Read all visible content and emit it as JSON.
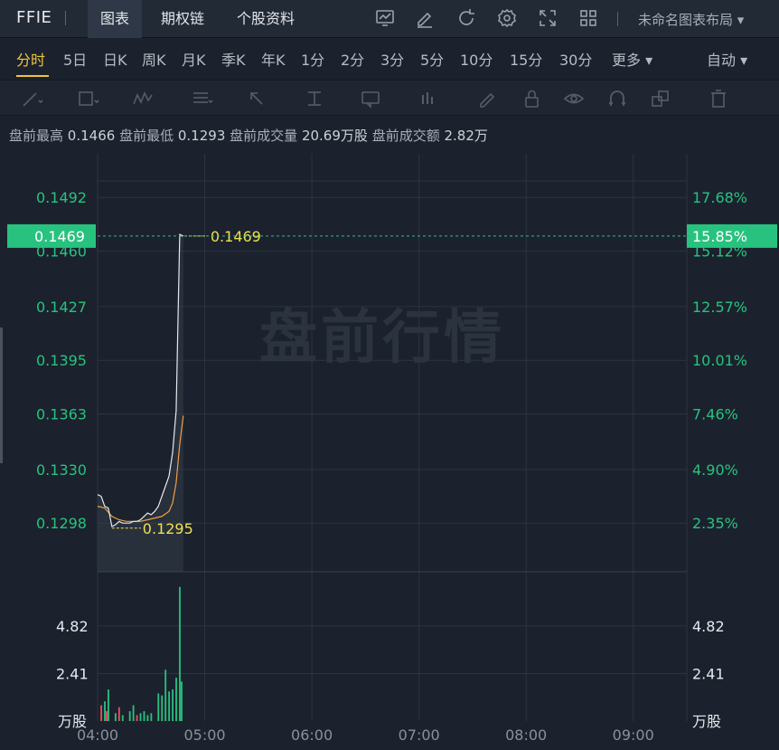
{
  "header": {
    "ticker": "FFIE",
    "tabs": [
      {
        "label": "图表",
        "active": true
      },
      {
        "label": "期权链",
        "active": false
      },
      {
        "label": "个股资料",
        "active": false
      }
    ],
    "icons": [
      "chart-add-icon",
      "edit-icon",
      "refresh-icon",
      "gear-icon",
      "fullscreen-icon",
      "grid-icon"
    ],
    "layout_label": "未命名图表布局"
  },
  "periods": {
    "items": [
      "分时",
      "5日",
      "日K",
      "周K",
      "月K",
      "季K",
      "年K",
      "1分",
      "2分",
      "3分",
      "5分",
      "10分",
      "15分",
      "30分",
      "更多"
    ],
    "active": "分时",
    "mode": "自动"
  },
  "draw_tools": [
    "line-tool-icon",
    "rect-tool-icon",
    "wave-tool-icon",
    "fib-tool-icon",
    "arrow-tool-icon",
    "text-level-icon",
    "text-label-icon",
    "bar-pattern-icon",
    "brush-icon",
    "lock-icon",
    "eye-icon",
    "magnet-icon",
    "layers-icon",
    "trash-icon"
  ],
  "info": {
    "high_label": "盘前最高",
    "high": "0.1466",
    "low_label": "盘前最低",
    "low": "0.1293",
    "volume_label": "盘前成交量",
    "volume": "20.69万股",
    "amount_label": "盘前成交额",
    "amount": "2.82万"
  },
  "watermark": "盘前行情",
  "colors": {
    "up": "#28c27f",
    "down": "#ef4d57",
    "price_line": "#e6e9ee",
    "avg_line": "#f0a040",
    "marker": "#f0e050",
    "grid": "#2c3440"
  },
  "chart_data": {
    "type": "line",
    "price_axis_left": [
      "0.1492",
      "0.1460",
      "0.1427",
      "0.1395",
      "0.1363",
      "0.1330",
      "0.1298"
    ],
    "price_axis_right": [
      "17.68%",
      "15.12%",
      "12.57%",
      "10.01%",
      "7.46%",
      "4.90%",
      "2.35%"
    ],
    "current_price": "0.1469",
    "current_pct": "15.85%",
    "max_marker": "0.1469",
    "min_marker": "0.1295",
    "ylim": [
      0.1269,
      0.1518
    ],
    "xlim": [
      0,
      330
    ],
    "time_ticks": [
      "04:00",
      "05:00",
      "06:00",
      "07:00",
      "08:00",
      "09:00"
    ],
    "time_tick_minutes": [
      0,
      60,
      120,
      180,
      240,
      300
    ],
    "price_series": {
      "x": [
        0,
        2,
        4,
        6,
        8,
        10,
        12,
        14,
        16,
        18,
        20,
        22,
        24,
        26,
        28,
        30,
        32,
        34,
        36,
        38,
        40,
        42,
        44,
        46,
        48
      ],
      "y": [
        0.1315,
        0.1314,
        0.1308,
        0.1307,
        0.1296,
        0.1297,
        0.1299,
        0.1298,
        0.1298,
        0.1298,
        0.1299,
        0.1299,
        0.13,
        0.1302,
        0.1304,
        0.1303,
        0.1305,
        0.1308,
        0.1314,
        0.132,
        0.1326,
        0.134,
        0.1365,
        0.147,
        0.1469
      ]
    },
    "avg_series": {
      "x": [
        0,
        4,
        8,
        12,
        16,
        20,
        24,
        28,
        32,
        36,
        40,
        42,
        44,
        46,
        48
      ],
      "y": [
        0.1308,
        0.1307,
        0.1302,
        0.13,
        0.1299,
        0.1299,
        0.1299,
        0.13,
        0.1301,
        0.1302,
        0.1305,
        0.131,
        0.1322,
        0.1345,
        0.1362
      ]
    },
    "volume_axis": [
      "4.82",
      "2.41"
    ],
    "volume_unit": "万股",
    "volume_ylim": [
      0,
      7.2
    ],
    "volume": {
      "x": [
        2,
        4,
        5,
        6,
        10,
        12,
        14,
        18,
        20,
        22,
        24,
        26,
        28,
        30,
        34,
        36,
        38,
        40,
        42,
        44,
        46,
        47
      ],
      "values": [
        0.8,
        1.0,
        0.5,
        1.6,
        0.4,
        0.7,
        0.3,
        0.5,
        0.8,
        0.3,
        0.4,
        0.5,
        0.3,
        0.4,
        1.4,
        1.3,
        2.6,
        1.5,
        1.6,
        2.2,
        6.8,
        2.0
      ],
      "dir": [
        "down",
        "up",
        "down",
        "up",
        "up",
        "down",
        "up",
        "up",
        "up",
        "down",
        "up",
        "up",
        "up",
        "up",
        "up",
        "up",
        "up",
        "up",
        "up",
        "up",
        "up",
        "up"
      ]
    }
  }
}
